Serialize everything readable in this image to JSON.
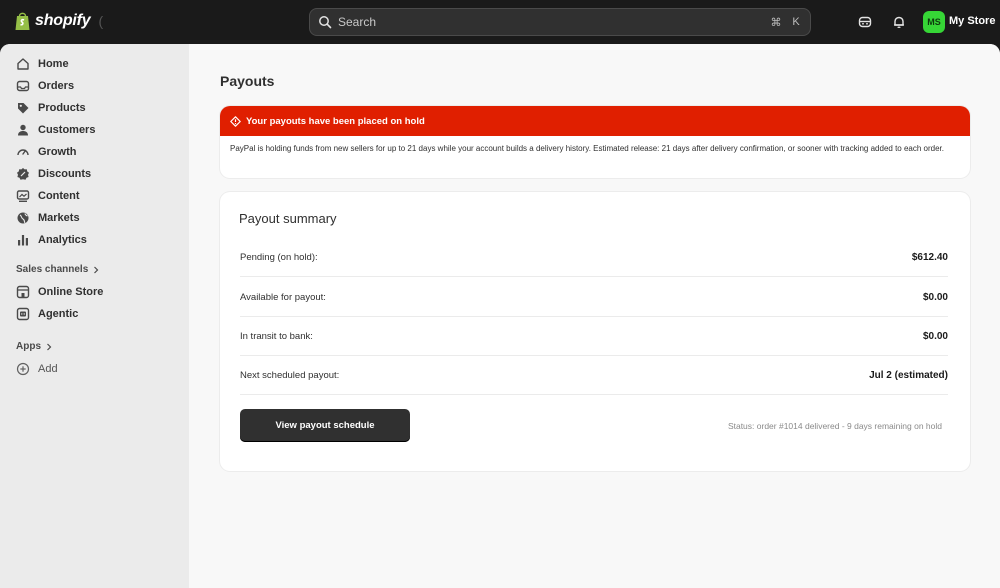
{
  "topbar": {
    "logo_text": "shopify",
    "logo_paren": "(",
    "search_placeholder": "Search",
    "shortcut_cmd": "⌘",
    "shortcut_key": "K",
    "avatar_initials": "MS",
    "store_name": "My Store",
    "icons": [
      "shopify-bag-icon",
      "search-icon",
      "sidekick-icon",
      "bell-icon"
    ]
  },
  "sidebar": {
    "items": [
      {
        "label": "Home",
        "icon": "home-icon"
      },
      {
        "label": "Orders",
        "icon": "inbox-icon"
      },
      {
        "label": "Products",
        "icon": "tag-icon"
      },
      {
        "label": "Customers",
        "icon": "person-icon"
      },
      {
        "label": "Growth",
        "icon": "gauge-icon"
      },
      {
        "label": "Discounts",
        "icon": "discount-icon"
      },
      {
        "label": "Content",
        "icon": "content-icon"
      },
      {
        "label": "Markets",
        "icon": "globe-icon"
      },
      {
        "label": "Analytics",
        "icon": "bar-chart-icon"
      }
    ],
    "sales_channels_label": "Sales channels",
    "channels": [
      {
        "label": "Online Store",
        "icon": "store-icon"
      },
      {
        "label": "Agentic",
        "icon": "agentic-icon"
      }
    ],
    "apps_label": "Apps",
    "add_label": "Add"
  },
  "main": {
    "page_title": "Payouts",
    "alert": {
      "title": "Your payouts have been placed on hold",
      "body": "PayPal is holding funds from new sellers for up to 21 days while your account builds a delivery history. Estimated release: 21 days after delivery confirmation, or sooner with tracking added to each order.",
      "color": "#e01f00"
    },
    "summary": {
      "title": "Payout summary",
      "rows": [
        {
          "label": "Pending (on hold):",
          "value": "$612.40"
        },
        {
          "label": "Available for payout:",
          "value": "$0.00"
        },
        {
          "label": "In transit to bank:",
          "value": "$0.00"
        },
        {
          "label": "Next scheduled payout:",
          "value": "Jul 2 (estimated)"
        }
      ],
      "button_label": "View payout schedule",
      "status": "Status: order #1014 delivered - 9 days remaining on hold"
    }
  }
}
